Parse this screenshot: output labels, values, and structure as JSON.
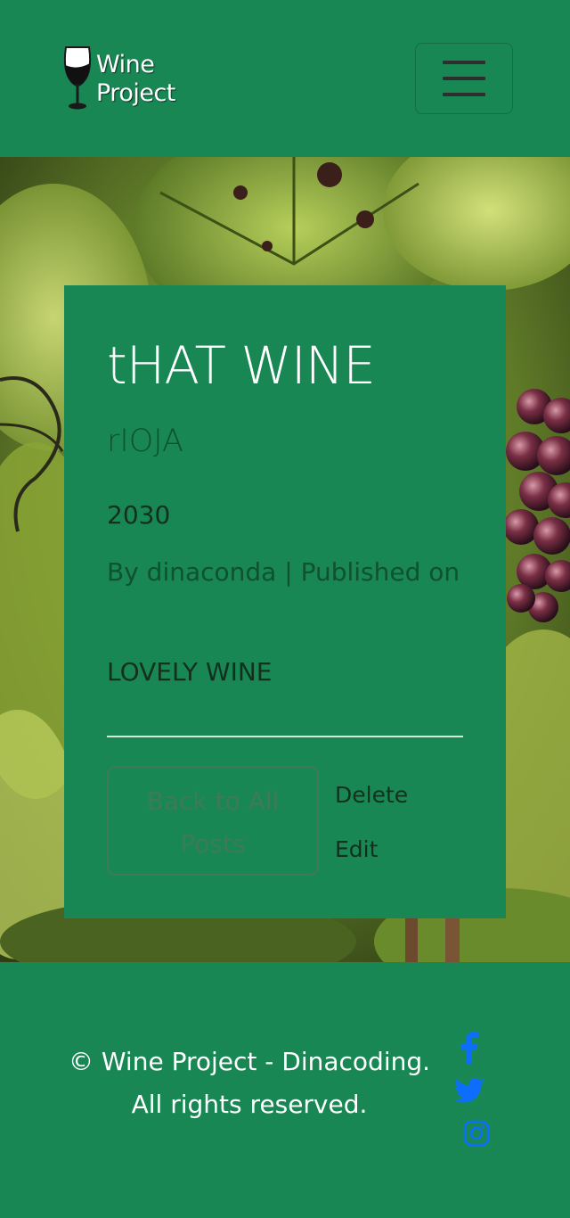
{
  "header": {
    "logo_line1": "Wine",
    "logo_line2": "Project",
    "menu_toggle_icon": "hamburger-icon"
  },
  "post": {
    "title": "tHAT WINE",
    "region": "rIOJA",
    "year": "2030",
    "meta": "By dinaconda | Published on",
    "body": "LOVELY WINE",
    "back_label": "Back to All Posts",
    "delete_label": "Delete",
    "edit_label": "Edit"
  },
  "footer": {
    "copyright": "© Wine Project - Dinacoding. All rights reserved.",
    "social": [
      {
        "icon": "facebook-icon"
      },
      {
        "icon": "twitter-icon"
      },
      {
        "icon": "instagram-icon"
      }
    ]
  },
  "colors": {
    "brand_green": "#188754",
    "social_blue": "#0d6efd"
  }
}
